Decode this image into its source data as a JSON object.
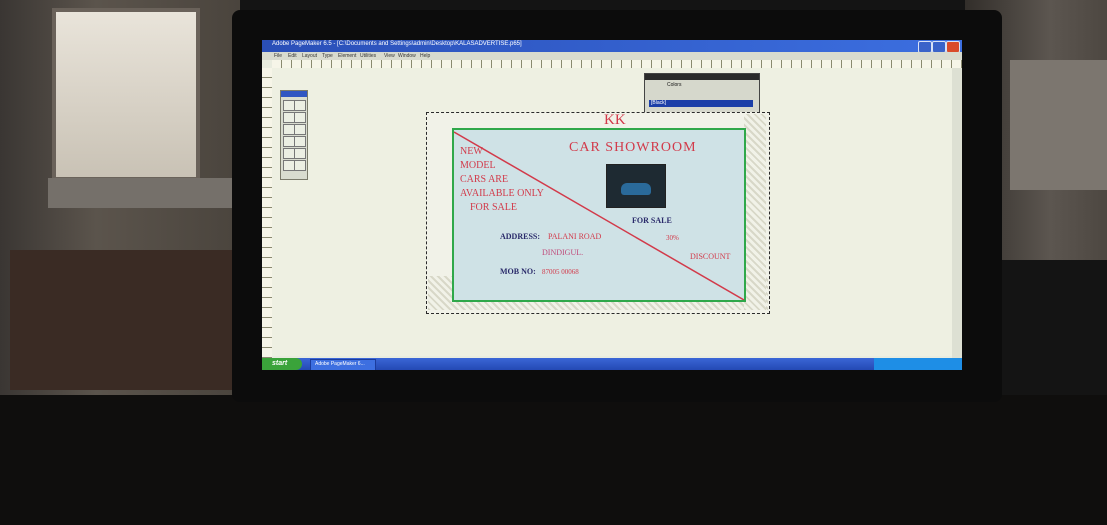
{
  "app": {
    "title": "Adobe PageMaker 6.5 - [C:\\Documents and Settings\\admin\\Desktop\\KALASADVERTISE.p65]",
    "menu": [
      "File",
      "Edit",
      "Layout",
      "Type",
      "Element",
      "Utilities",
      "View",
      "Window",
      "Help"
    ]
  },
  "palette": {
    "tab_label": "Colors",
    "selected_swatch": "[Black]"
  },
  "flyer": {
    "top_text": "KK",
    "headline": "CAR   SHOWROOM",
    "side_lines": [
      "NEW",
      "MODEL",
      "CARS  ARE",
      "AVAILABLE ONLY",
      "FOR  SALE"
    ],
    "for_sale": "FOR SALE",
    "address_label": "ADDRESS:",
    "address_value": "PALANI ROAD",
    "city": "DINDIGUL.",
    "percent": "30%",
    "discount": "DISCOUNT",
    "mob_label": "MOB   NO:",
    "mob_value": "87005 00068"
  },
  "taskbar": {
    "start_label": "start",
    "task_label": "Adobe PageMaker 6..."
  },
  "colors": {
    "flyer_text": "#d23a4a",
    "flyer_bg": "#cfe2e6",
    "flyer_border": "#2fa84a",
    "titlebar": "#2a4fb8"
  }
}
